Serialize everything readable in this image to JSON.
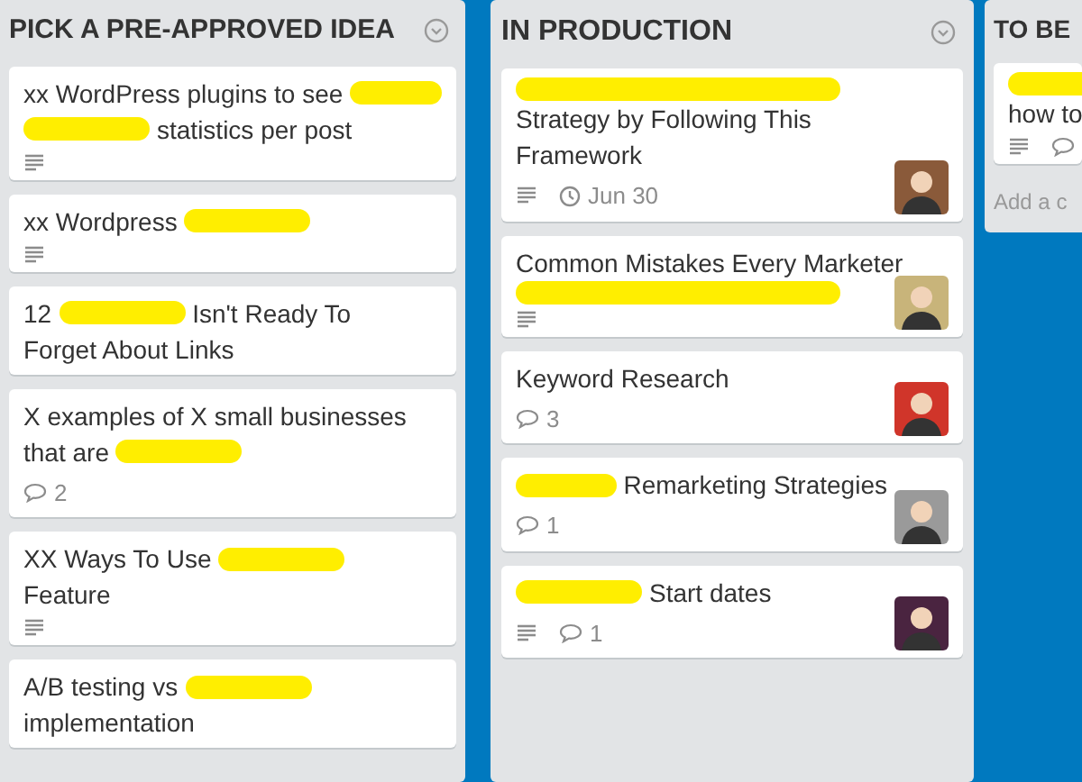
{
  "lists": [
    {
      "title": "PICK A PRE-APPROVED IDEA",
      "cards": [
        {
          "lines": [
            [
              {
                "kind": "text",
                "text": "xx WordPress plugins to see"
              },
              {
                "kind": "redaction"
              }
            ],
            [
              {
                "kind": "redaction"
              },
              {
                "kind": "text",
                "text": "statistics per post"
              }
            ]
          ],
          "badges": [
            {
              "kind": "description"
            }
          ]
        },
        {
          "lines": [
            [
              {
                "kind": "text",
                "text": "xx Wordpress"
              },
              {
                "kind": "redaction"
              }
            ]
          ],
          "badges": [
            {
              "kind": "description"
            }
          ]
        },
        {
          "lines": [
            [
              {
                "kind": "text",
                "text": "12"
              },
              {
                "kind": "redaction"
              },
              {
                "kind": "text",
                "text": "Isn't Ready To"
              }
            ],
            [
              {
                "kind": "text",
                "text": "Forget About Links"
              }
            ]
          ]
        },
        {
          "lines": [
            [
              {
                "kind": "text",
                "text": "X examples of X small businesses"
              }
            ],
            [
              {
                "kind": "text",
                "text": "that are"
              },
              {
                "kind": "redaction"
              }
            ]
          ],
          "badges": [
            {
              "kind": "comments",
              "text": "2"
            }
          ]
        },
        {
          "lines": [
            [
              {
                "kind": "text",
                "text": "XX Ways To Use"
              },
              {
                "kind": "redaction"
              }
            ],
            [
              {
                "kind": "text",
                "text": "Feature"
              }
            ]
          ],
          "badges": [
            {
              "kind": "description"
            }
          ]
        },
        {
          "lines": [
            [
              {
                "kind": "text",
                "text": "A/B testing vs"
              },
              {
                "kind": "redaction"
              }
            ],
            [
              {
                "kind": "text",
                "text": "implementation"
              }
            ]
          ]
        }
      ]
    },
    {
      "title": "IN PRODUCTION",
      "cards": [
        {
          "lines": [
            [
              {
                "kind": "redaction"
              }
            ],
            [
              {
                "kind": "text",
                "text": "Strategy by Following This"
              }
            ],
            [
              {
                "kind": "text",
                "text": "Framework"
              }
            ]
          ],
          "badges": [
            {
              "kind": "description"
            },
            {
              "kind": "due",
              "text": "Jun 30"
            }
          ],
          "avatar": {
            "color": "#8a5a3a"
          }
        },
        {
          "lines": [
            [
              {
                "kind": "text",
                "text": "Common Mistakes Every Marketer"
              }
            ],
            [
              {
                "kind": "redaction"
              }
            ]
          ],
          "badges": [
            {
              "kind": "description"
            }
          ],
          "avatar": {
            "color": "#c8b47a"
          }
        },
        {
          "lines": [
            [
              {
                "kind": "text",
                "text": "Keyword Research"
              }
            ]
          ],
          "badges": [
            {
              "kind": "comments",
              "text": "3"
            }
          ],
          "avatar": {
            "color": "#d0352a"
          }
        },
        {
          "lines": [
            [
              {
                "kind": "redaction"
              },
              {
                "kind": "text",
                "text": "Remarketing Strategies"
              }
            ]
          ],
          "badges": [
            {
              "kind": "comments",
              "text": "1"
            }
          ],
          "avatar": {
            "color": "#9a9a9a"
          }
        },
        {
          "lines": [
            [
              {
                "kind": "redaction"
              },
              {
                "kind": "text",
                "text": "Start dates"
              }
            ]
          ],
          "badges": [
            {
              "kind": "description"
            },
            {
              "kind": "comments",
              "text": "1"
            }
          ],
          "avatar": {
            "color": "#4a2440"
          }
        }
      ]
    },
    {
      "title": "TO BE",
      "cards": [
        {
          "lines": [
            [
              {
                "kind": "redaction"
              }
            ],
            [
              {
                "kind": "text",
                "text": "how to"
              }
            ]
          ],
          "badges": [
            {
              "kind": "description"
            },
            {
              "kind": "comments"
            }
          ]
        }
      ],
      "add_card": "Add a c"
    }
  ]
}
